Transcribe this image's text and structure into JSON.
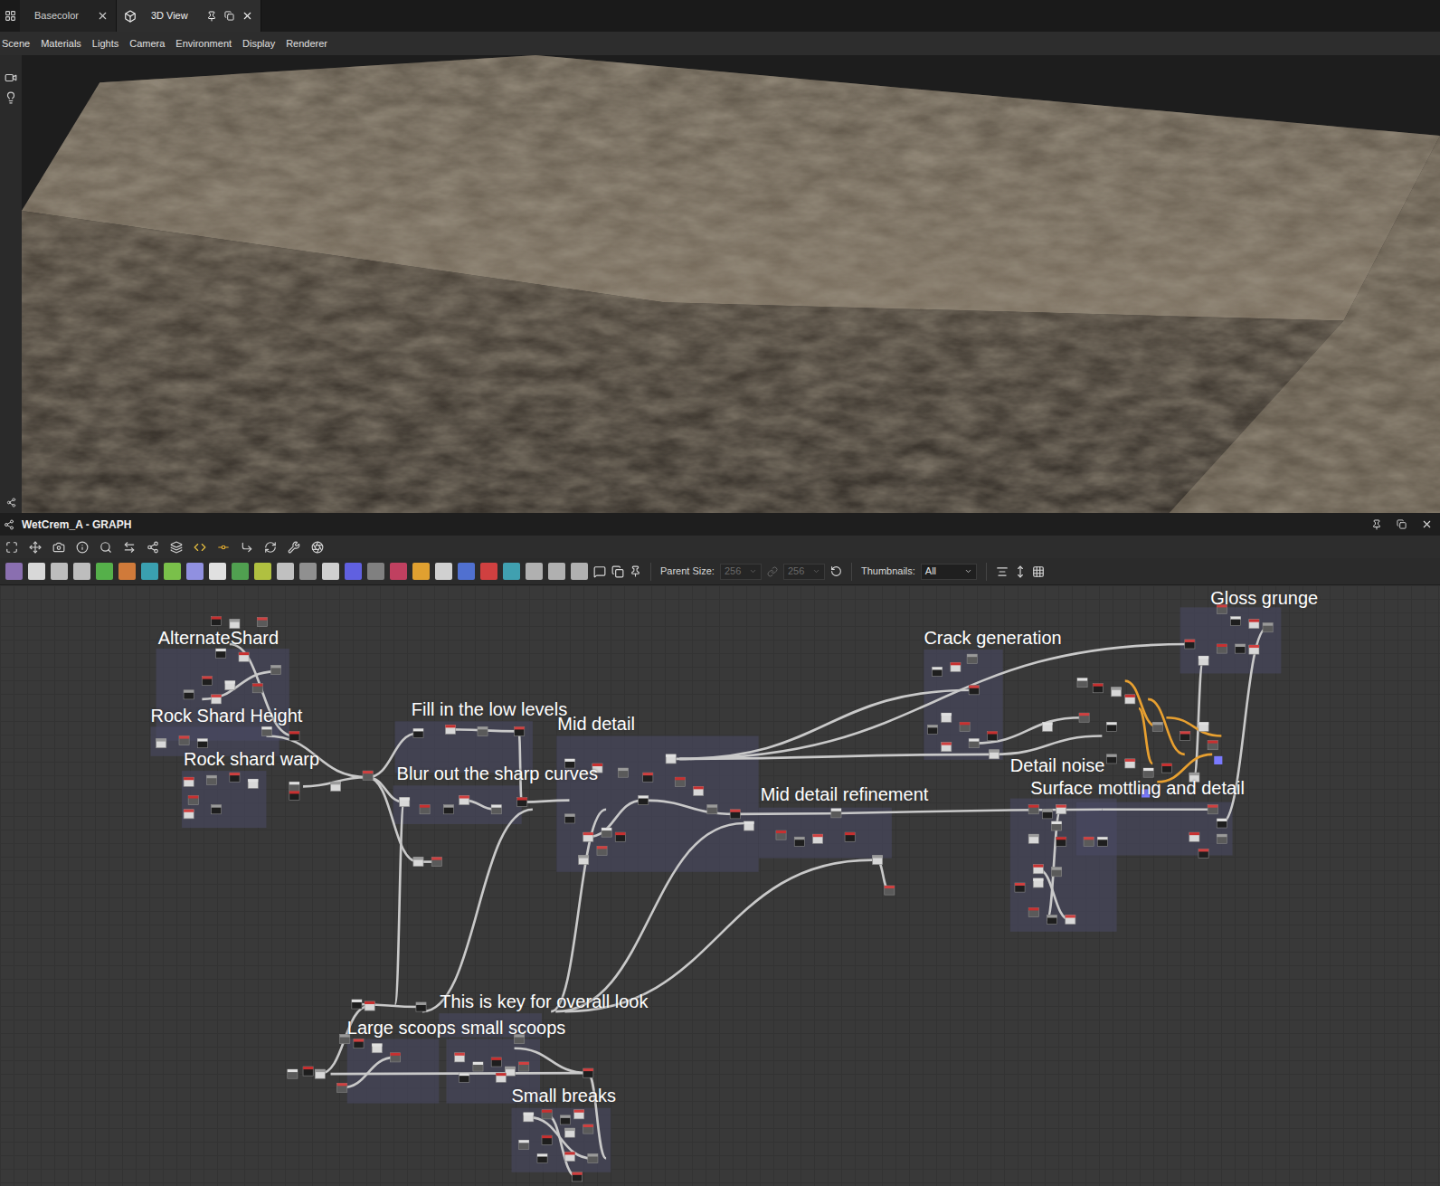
{
  "tabs": [
    {
      "label": "Basecolor",
      "selected": false
    },
    {
      "label": "3D View",
      "selected": true
    }
  ],
  "viewport_menu": [
    "Scene",
    "Materials",
    "Lights",
    "Camera",
    "Environment",
    "Display",
    "Renderer"
  ],
  "graph": {
    "title": "WetCrem_A - GRAPH",
    "parent_size": {
      "label": "Parent Size:",
      "width": "256",
      "height": "256",
      "disabled": true
    },
    "thumbnails": {
      "label": "Thumbnails:",
      "value": "All"
    },
    "frames": [
      {
        "label": "AlternateShard"
      },
      {
        "label": "Rock Shard Height"
      },
      {
        "label": "Rock shard warp"
      },
      {
        "label": "Fill in the low levels"
      },
      {
        "label": "Blur out the sharp curves"
      },
      {
        "label": "Mid detail"
      },
      {
        "label": "Mid detail refinement"
      },
      {
        "label": "Crack generation"
      },
      {
        "label": "Gloss grunge"
      },
      {
        "label": "Detail noise"
      },
      {
        "label": "Surface mottling and detail"
      },
      {
        "label": "This is key for overall look"
      },
      {
        "label": "Large scoops"
      },
      {
        "label": "small scoops"
      },
      {
        "label": "Small breaks"
      }
    ]
  }
}
